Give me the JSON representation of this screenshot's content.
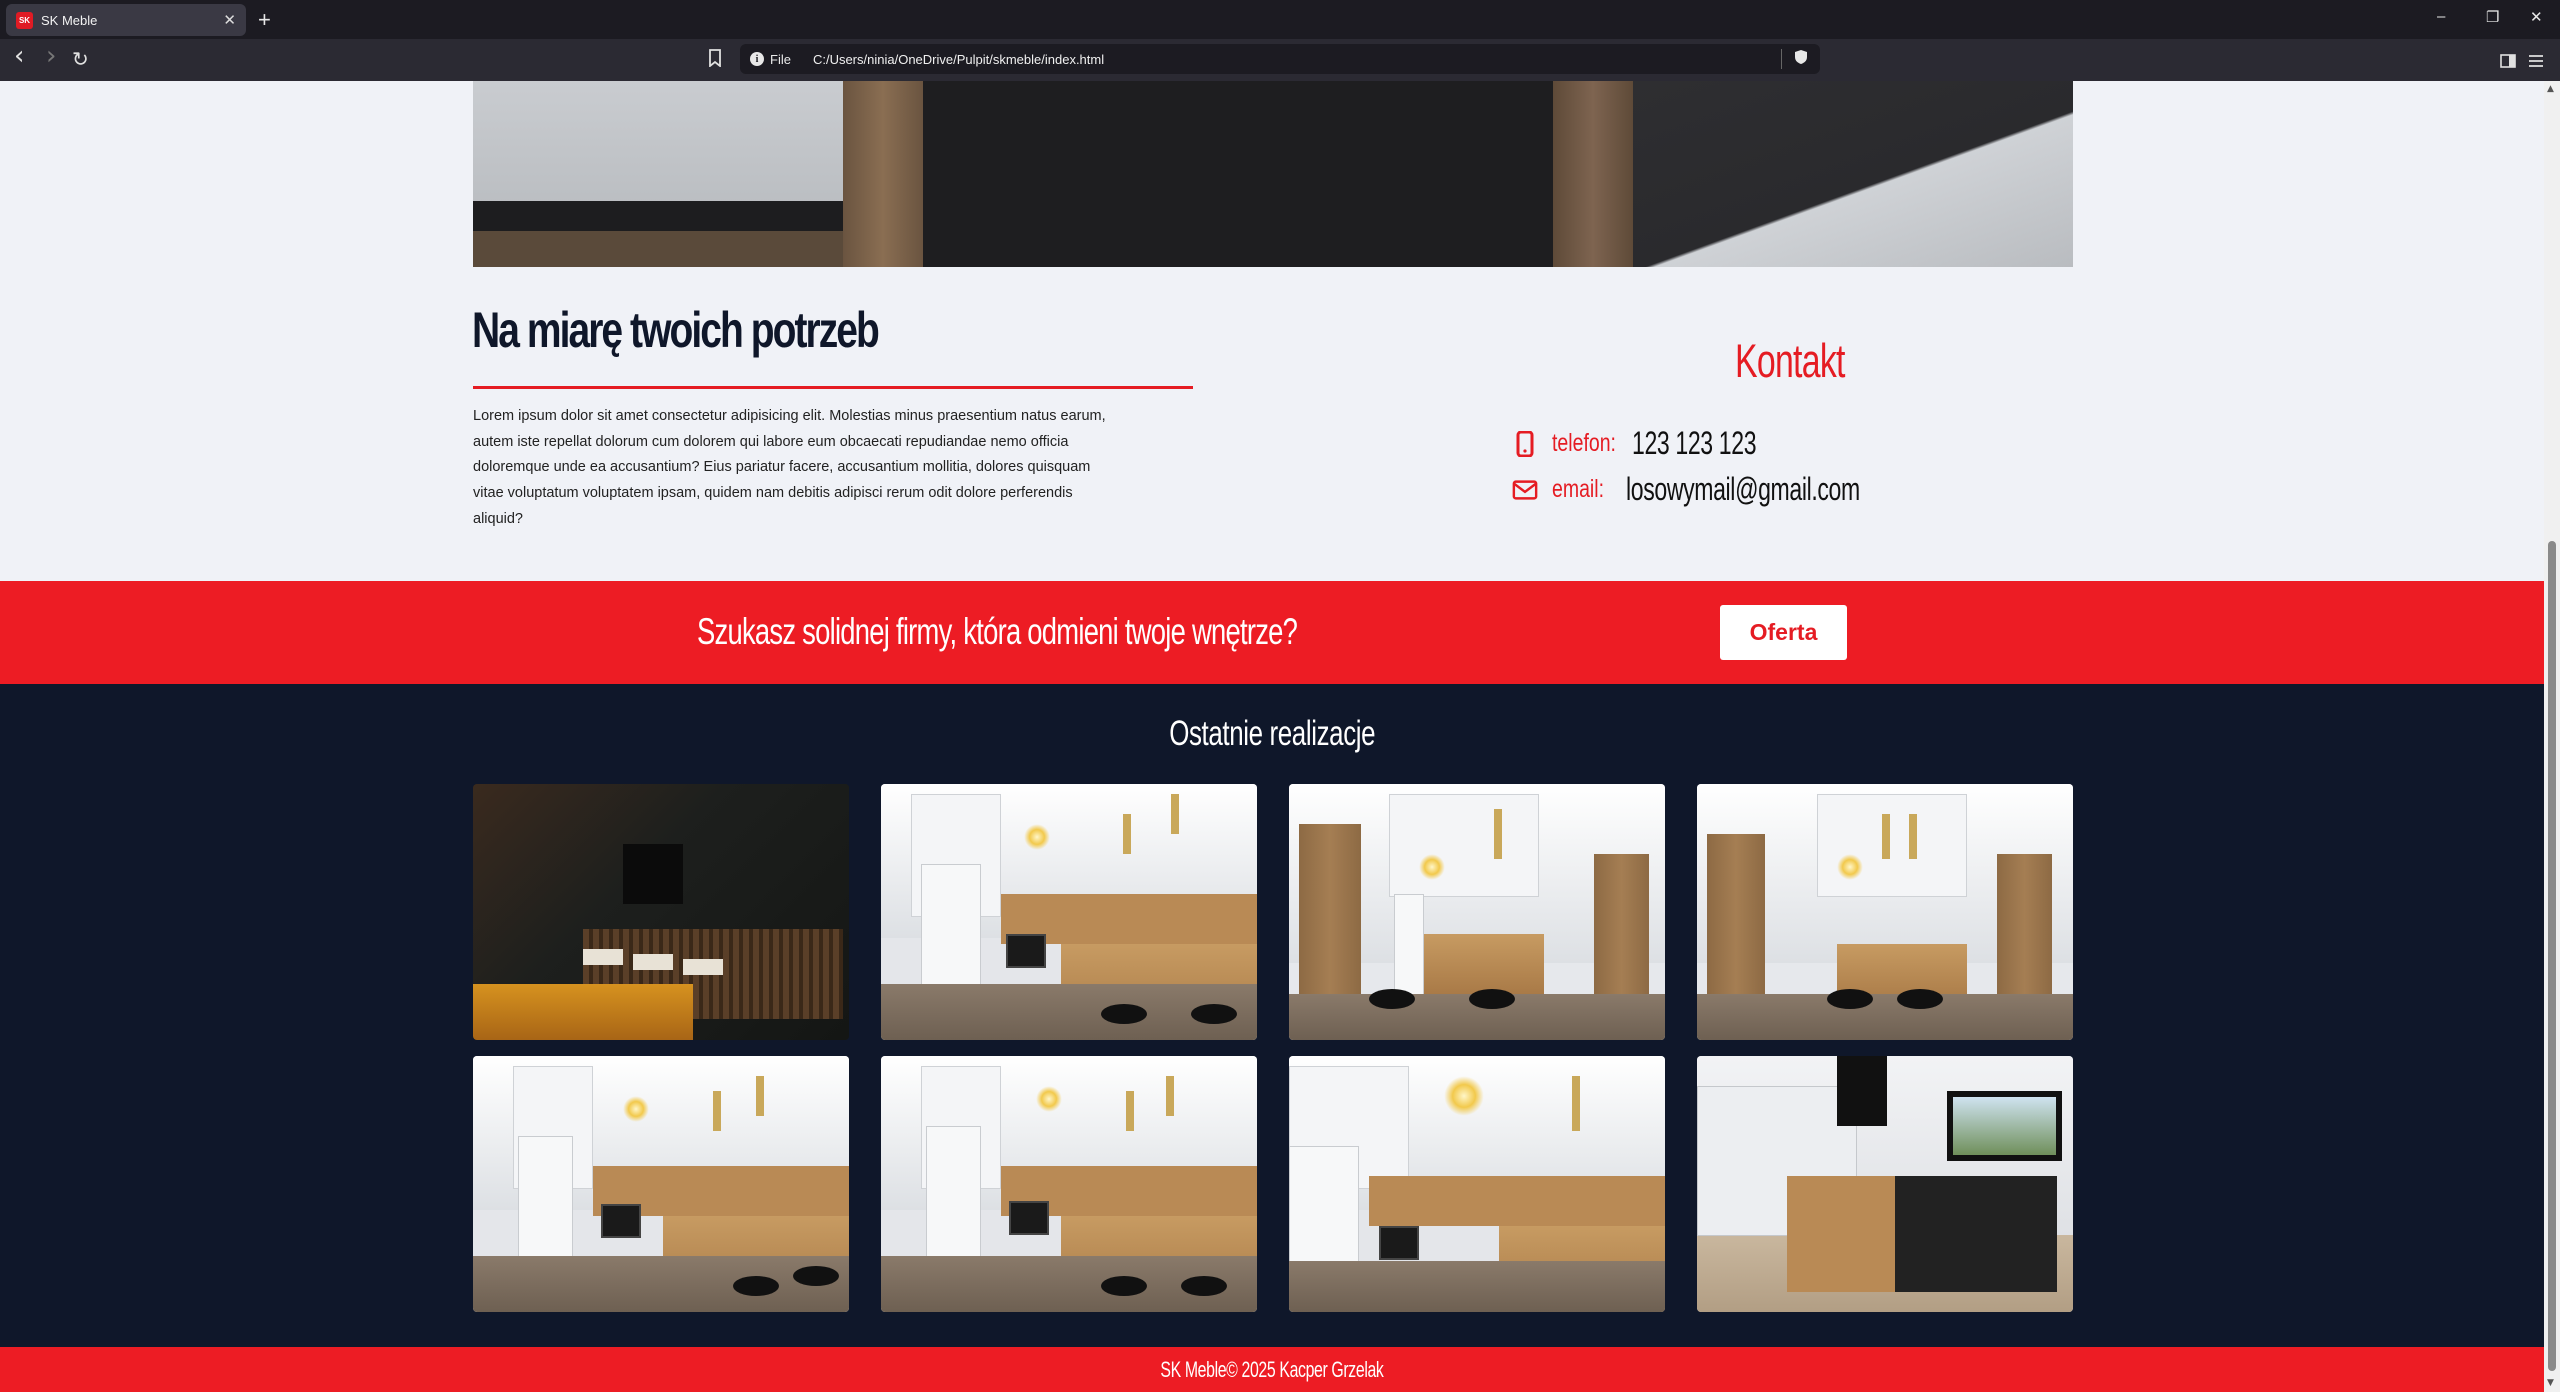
{
  "browser": {
    "tab_title": "SK Meble",
    "tab_favicon_text": "SK",
    "tab_close": "✕",
    "new_tab": "+",
    "url_scheme_label": "File",
    "url": "C:/Users/ninia/OneDrive/Pulpit/skmeble/index.html",
    "window_controls": {
      "minimize": "–",
      "restore": "❐",
      "close": "✕"
    },
    "nav": {
      "back": "‹",
      "forward": "›",
      "reload": "↻"
    }
  },
  "about": {
    "title": "Na miarę twoich potrzeb",
    "text": "Lorem ipsum dolor sit amet consectetur adipisicing elit. Molestias minus praesentium natus earum, autem iste repellat dolorum cum dolorem qui labore eum obcaecati repudiandae nemo officia doloremque unde ea accusantium? Eius pariatur facere, accusantium mollitia, dolores quisquam vitae voluptatum voluptatem ipsam, quidem nam debitis adipisci rerum odit dolore perferendis aliquid?"
  },
  "contact": {
    "title": "Kontakt",
    "phone_label": "telefon:",
    "phone_value": "123 123 123",
    "email_label": "email:",
    "email_value": "losowymail@gmail.com"
  },
  "cta": {
    "text": "Szukasz solidnej firmy, która odmieni twoje wnętrze?",
    "button_label": "Oferta"
  },
  "gallery": {
    "title": "Ostatnie realizacje",
    "photos": [
      "kitchen-photo-1",
      "kitchen-photo-2",
      "kitchen-photo-3",
      "kitchen-photo-4",
      "kitchen-photo-5",
      "kitchen-photo-6",
      "kitchen-photo-7",
      "kitchen-photo-8"
    ]
  },
  "footer": {
    "text": "SK Meble© 2025 Kacper Grzelak"
  },
  "colors": {
    "accent": "#ed1c24",
    "dark": "#0f172a",
    "background": "#f0f2f7"
  },
  "icons": {
    "phone": "mobile-phone-icon",
    "email": "envelope-icon",
    "bookmark": "bookmark-icon",
    "info": "info-icon",
    "shield": "shield-icon"
  }
}
